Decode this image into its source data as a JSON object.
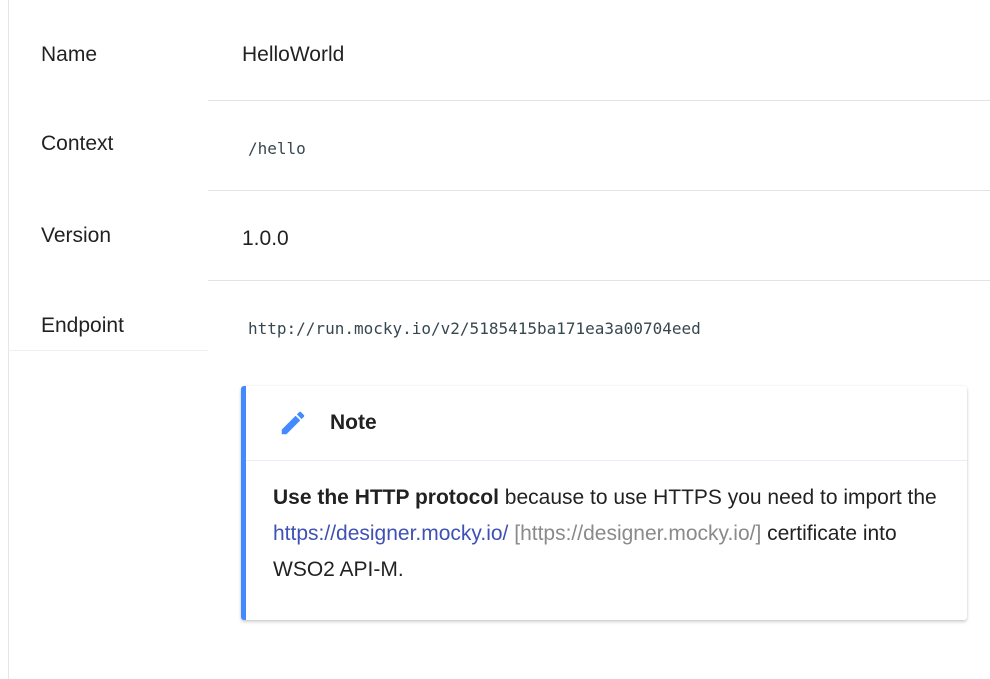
{
  "rows": [
    {
      "label": "Name",
      "value": "HelloWorld"
    },
    {
      "label": "Context",
      "value": "/hello"
    },
    {
      "label": "Version",
      "value": "1.0.0"
    },
    {
      "label": "Endpoint",
      "value": "http://run.mocky.io/v2/5185415ba171ea3a00704eed"
    }
  ],
  "note": {
    "icon": "pencil-icon",
    "title": "Note",
    "bold_lead": "Use the HTTP protocol",
    "text_1": " because to use HTTPS you need to import the ",
    "link_text": "https://designer.mocky.io/",
    "bracket_url": "[https://designer.mocky.io/]",
    "text_2": " certificate into WSO2 API-M.",
    "accent_color": "#448aff"
  }
}
